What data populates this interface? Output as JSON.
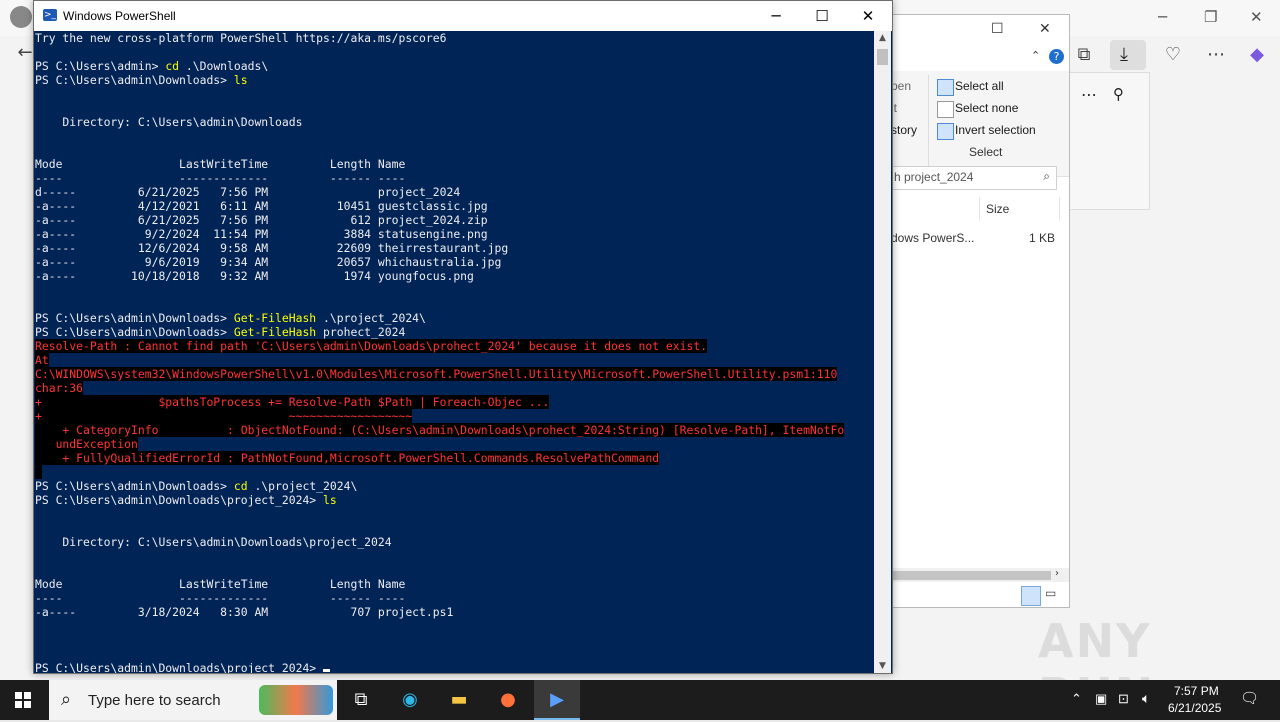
{
  "powershell": {
    "title": "Windows PowerShell",
    "controls": {
      "minimize": "─",
      "maximize": "☐",
      "close": "✕"
    },
    "lines": [
      {
        "t": "Try the new cross-platform PowerShell https://aka.ms/pscore6",
        "k": "n"
      },
      {
        "t": "",
        "k": "n"
      },
      {
        "p": "PS C:\\Users\\admin> ",
        "c": "cd",
        "a": " .\\Downloads\\",
        "k": "cmd"
      },
      {
        "p": "PS C:\\Users\\admin\\Downloads> ",
        "c": "ls",
        "a": "",
        "k": "cmd"
      },
      {
        "t": "",
        "k": "n"
      },
      {
        "t": "",
        "k": "n"
      },
      {
        "t": "    Directory: C:\\Users\\admin\\Downloads",
        "k": "n"
      },
      {
        "t": "",
        "k": "n"
      },
      {
        "t": "",
        "k": "n"
      },
      {
        "t": "Mode                 LastWriteTime         Length Name",
        "k": "n"
      },
      {
        "t": "----                 -------------         ------ ----",
        "k": "n"
      },
      {
        "t": "d-----         6/21/2025   7:56 PM                project_2024",
        "k": "n"
      },
      {
        "t": "-a----         4/12/2021   6:11 AM          10451 guestclassic.jpg",
        "k": "n"
      },
      {
        "t": "-a----         6/21/2025   7:56 PM            612 project_2024.zip",
        "k": "n"
      },
      {
        "t": "-a----          9/2/2024  11:54 PM           3884 statusengine.png",
        "k": "n"
      },
      {
        "t": "-a----         12/6/2024   9:58 AM          22609 theirrestaurant.jpg",
        "k": "n"
      },
      {
        "t": "-a----          9/6/2019   9:34 AM          20657 whichaustralia.jpg",
        "k": "n"
      },
      {
        "t": "-a----        10/18/2018   9:32 AM           1974 youngfocus.png",
        "k": "n"
      },
      {
        "t": "",
        "k": "n"
      },
      {
        "t": "",
        "k": "n"
      },
      {
        "p": "PS C:\\Users\\admin\\Downloads> ",
        "c": "Get-FileHash",
        "a": " .\\project_2024\\",
        "k": "cmd"
      },
      {
        "p": "PS C:\\Users\\admin\\Downloads> ",
        "c": "Get-FileHash",
        "a": " prohect_2024",
        "k": "cmd"
      },
      {
        "t": "Resolve-Path : Cannot find path 'C:\\Users\\admin\\Downloads\\prohect_2024' because it does not exist.",
        "k": "err"
      },
      {
        "t": "At",
        "k": "err"
      },
      {
        "t": "C:\\WINDOWS\\system32\\WindowsPowerShell\\v1.0\\Modules\\Microsoft.PowerShell.Utility\\Microsoft.PowerShell.Utility.psm1:110",
        "k": "err"
      },
      {
        "t": "char:36",
        "k": "err"
      },
      {
        "t": "+                 $pathsToProcess += Resolve-Path $Path | Foreach-Objec ...",
        "k": "err"
      },
      {
        "t": "+                                    ~~~~~~~~~~~~~~~~~~",
        "k": "err"
      },
      {
        "t": "    + CategoryInfo          : ObjectNotFound: (C:\\Users\\admin\\Downloads\\prohect_2024:String) [Resolve-Path], ItemNotFo",
        "k": "err"
      },
      {
        "t": "   undException",
        "k": "err"
      },
      {
        "t": "    + FullyQualifiedErrorId : PathNotFound,Microsoft.PowerShell.Commands.ResolvePathCommand",
        "k": "err"
      },
      {
        "t": " ",
        "k": "err"
      },
      {
        "p": "PS C:\\Users\\admin\\Downloads> ",
        "c": "cd",
        "a": " .\\project_2024\\",
        "k": "cmd"
      },
      {
        "p": "PS C:\\Users\\admin\\Downloads\\project_2024> ",
        "c": "ls",
        "a": "",
        "k": "cmd"
      },
      {
        "t": "",
        "k": "n"
      },
      {
        "t": "",
        "k": "n"
      },
      {
        "t": "    Directory: C:\\Users\\admin\\Downloads\\project_2024",
        "k": "n"
      },
      {
        "t": "",
        "k": "n"
      },
      {
        "t": "",
        "k": "n"
      },
      {
        "t": "Mode                 LastWriteTime         Length Name",
        "k": "n"
      },
      {
        "t": "----                 -------------         ------ ----",
        "k": "n"
      },
      {
        "t": "-a----         3/18/2024   8:30 AM            707 project.ps1",
        "k": "n"
      },
      {
        "t": "",
        "k": "n"
      },
      {
        "t": "",
        "k": "n"
      },
      {
        "t": "",
        "k": "n"
      }
    ],
    "prompt": "PS C:\\Users\\admin\\Downloads\\project_2024> "
  },
  "explorer": {
    "ribbon": {
      "select_all": "Select all",
      "select_none": "Select none",
      "invert_selection": "Invert selection",
      "group_label": "Select",
      "partial_open": "pen",
      "partial_it": "it",
      "partial_history": "story"
    },
    "search_placeholder": "h project_2024",
    "column_size": "Size",
    "row_name": "dows PowerS...",
    "row_size": "1 KB"
  },
  "taskbar": {
    "search_placeholder": "Type here to search",
    "time": "7:57 PM",
    "date": "6/21/2025"
  },
  "watermark": "ANY RUN"
}
